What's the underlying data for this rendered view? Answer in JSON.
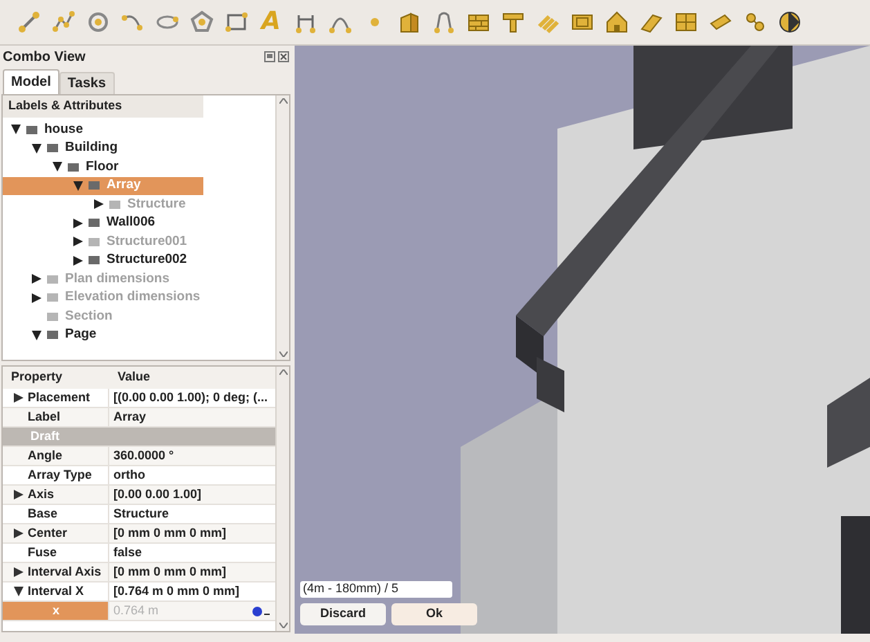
{
  "toolbar_glyph": "A",
  "combo_view": {
    "title": "Combo View",
    "tabs": [
      {
        "label": "Model",
        "selected": true
      },
      {
        "label": "Tasks",
        "selected": false
      }
    ],
    "tree": {
      "header": "Labels & Attributes",
      "items": [
        {
          "label": "house",
          "expanded": true,
          "hidden": false,
          "selected": false,
          "children": [
            {
              "label": "Building",
              "expanded": true,
              "hidden": false,
              "selected": false,
              "children": [
                {
                  "label": "Floor",
                  "expanded": true,
                  "hidden": false,
                  "selected": false,
                  "children": [
                    {
                      "label": "Array",
                      "expanded": true,
                      "hidden": false,
                      "selected": true,
                      "children": [
                        {
                          "label": "Structure",
                          "expanded": false,
                          "hidden": true,
                          "selected": false
                        }
                      ]
                    },
                    {
                      "label": "Wall006",
                      "expanded": false,
                      "hidden": false,
                      "selected": false
                    },
                    {
                      "label": "Structure001",
                      "expanded": false,
                      "hidden": true,
                      "selected": false
                    },
                    {
                      "label": "Structure002",
                      "expanded": false,
                      "hidden": false,
                      "selected": false
                    }
                  ]
                }
              ]
            },
            {
              "label": "Plan dimensions",
              "expanded": false,
              "hidden": true,
              "selected": false
            },
            {
              "label": "Elevation dimensions",
              "expanded": false,
              "hidden": true,
              "selected": false
            },
            {
              "label": "Section",
              "hidden": true,
              "selected": false
            },
            {
              "label": "Page",
              "expanded": true,
              "hidden": false,
              "selected": false
            }
          ]
        }
      ]
    }
  },
  "properties": {
    "columns": [
      "Property",
      "Value"
    ],
    "rows": [
      {
        "kind": "property",
        "name": "Placement",
        "value": "[(0.00 0.00 1.00); 0 deg; (...",
        "expanded": false,
        "selected": false
      },
      {
        "kind": "property",
        "name": "Label",
        "value": "Array",
        "selected": false
      },
      {
        "kind": "group",
        "name": "Draft"
      },
      {
        "kind": "property",
        "name": "Angle",
        "value": "360.0000 °",
        "selected": false
      },
      {
        "kind": "property",
        "name": "Array Type",
        "value": "ortho",
        "selected": false
      },
      {
        "kind": "property",
        "name": "Axis",
        "value": "[0.00 0.00 1.00]",
        "expanded": false,
        "selected": false
      },
      {
        "kind": "property",
        "name": "Base",
        "value": "Structure",
        "selected": false
      },
      {
        "kind": "property",
        "name": "Center",
        "value": "[0 mm  0 mm  0 mm]",
        "expanded": false,
        "selected": false
      },
      {
        "kind": "property",
        "name": "Fuse",
        "value": "false",
        "selected": false
      },
      {
        "kind": "property",
        "name": "Interval Axis",
        "value": "[0 mm  0 mm  0 mm]",
        "expanded": false,
        "selected": false
      },
      {
        "kind": "property",
        "name": "Interval X",
        "value": "[0.764 m  0 mm  0 mm]",
        "expanded": true,
        "selected": false
      },
      {
        "kind": "editor",
        "name": "x",
        "value": "0.764 m",
        "selected": true
      }
    ]
  },
  "expression": {
    "value": "(4m - 180mm) / 5",
    "buttons": [
      "Discard",
      "Ok"
    ]
  }
}
